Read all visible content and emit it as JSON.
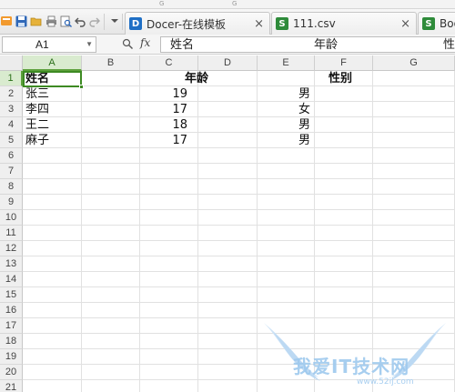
{
  "top_strip": {
    "marks": [
      "G",
      "G"
    ]
  },
  "toolbar": {
    "icons": [
      "app-menu-icon",
      "save-icon",
      "open-icon",
      "print-icon",
      "print-preview-icon",
      "undo-icon",
      "redo-icon",
      "customize-dropdown-icon"
    ]
  },
  "tabs": [
    {
      "label": "Docer-在线模板",
      "icon": "docer-icon",
      "color": "#1f6fc5",
      "close": "×"
    },
    {
      "label": "111.csv",
      "icon": "spreadsheet-icon",
      "color": "#2e8b3a",
      "close": "×"
    },
    {
      "label": "Boo",
      "icon": "spreadsheet-icon",
      "color": "#2e8b3a"
    }
  ],
  "formula_bar": {
    "name_box": "A1",
    "fx": "fx",
    "content_segments": [
      "姓名",
      "年龄",
      "性"
    ]
  },
  "sheet": {
    "columns": [
      "A",
      "B",
      "C",
      "D",
      "E",
      "F",
      "G"
    ],
    "selected_column": "A",
    "rows": [
      "1",
      "2",
      "3",
      "4",
      "5",
      "6",
      "7",
      "8",
      "9",
      "10",
      "11",
      "12",
      "13",
      "14",
      "15",
      "16",
      "17",
      "18",
      "19",
      "20",
      "21"
    ],
    "selected_row": "1",
    "header_row": [
      "姓名",
      "年龄",
      "性别"
    ],
    "data_rows": [
      {
        "name": "张三",
        "age": "19",
        "gender": "男"
      },
      {
        "name": "李四",
        "age": "17",
        "gender": "女"
      },
      {
        "name": "王二",
        "age": "18",
        "gender": "男"
      },
      {
        "name": "麻子",
        "age": "17",
        "gender": "男"
      }
    ]
  },
  "watermark": {
    "text": "我爱IT技术网",
    "url": "www.52ij.com"
  },
  "colors": {
    "accent_green": "#3d8a23",
    "header_bg": "#efefef",
    "selection_bg": "#d9ebcf"
  }
}
